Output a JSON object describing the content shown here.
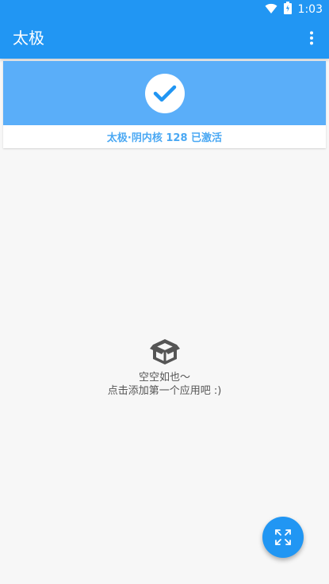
{
  "status_bar": {
    "time": "1:03",
    "icons": [
      "wifi-icon",
      "battery-icon"
    ]
  },
  "app_bar": {
    "title": "太极",
    "overflow_icon": "more-vert-icon"
  },
  "activation_card": {
    "icon": "check-icon",
    "status_text": "太极·阴内核 128 已激活"
  },
  "empty_state": {
    "icon": "empty-box-icon",
    "line1": "空空如也～",
    "line2": "点击添加第一个应用吧 :)"
  },
  "fab": {
    "icon": "expand-arrows-icon"
  },
  "colors": {
    "primary": "#2196f3",
    "hero": "#5aaef9",
    "status_text": "#4aa8f3",
    "background": "#f7f7f7"
  }
}
